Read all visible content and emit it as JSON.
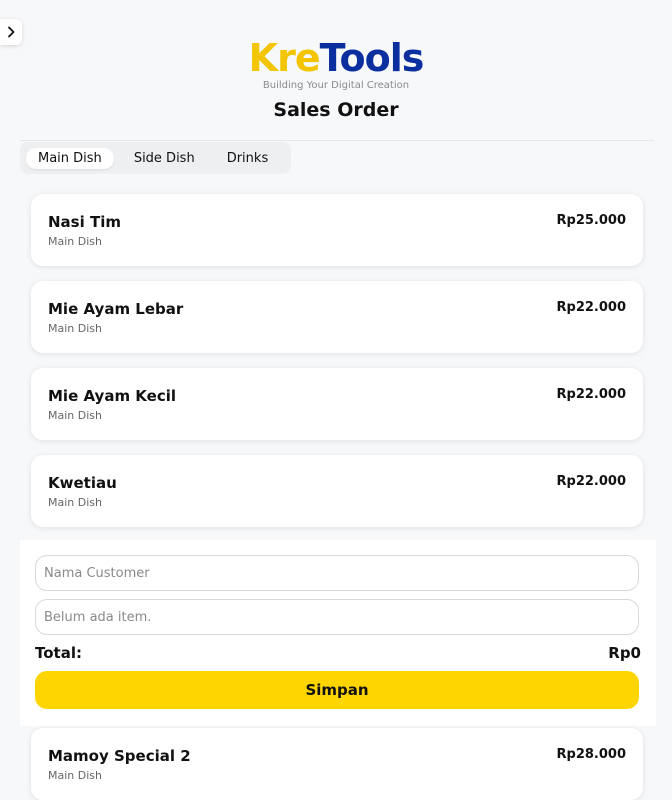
{
  "brand": {
    "logo_part1": "Kre",
    "logo_part2": "Tools",
    "tagline": "Building Your Digital Creation"
  },
  "page": {
    "title": "Sales Order"
  },
  "tabs": [
    {
      "label": "Main Dish",
      "active": true
    },
    {
      "label": "Side Dish",
      "active": false
    },
    {
      "label": "Drinks",
      "active": false
    }
  ],
  "products": [
    {
      "name": "Nasi Tim",
      "category": "Main Dish",
      "price": "Rp25.000"
    },
    {
      "name": "Mie Ayam Lebar",
      "category": "Main Dish",
      "price": "Rp22.000"
    },
    {
      "name": "Mie Ayam Kecil",
      "category": "Main Dish",
      "price": "Rp22.000"
    },
    {
      "name": "Kwetiau",
      "category": "Main Dish",
      "price": "Rp22.000"
    },
    {
      "name": "Mamoy Special 2",
      "category": "Main Dish",
      "price": "Rp28.000"
    }
  ],
  "order": {
    "customer_placeholder": "Nama Customer",
    "customer_value": "",
    "empty_items_text": "Belum ada item.",
    "total_label": "Total:",
    "total_value": "Rp0",
    "save_label": "Simpan"
  },
  "colors": {
    "accent": "#ffd500",
    "logo_yellow": "#f2c500",
    "logo_blue": "#0b2f9e"
  },
  "icons": {
    "sidebar_toggle": "chevron-right-icon"
  }
}
